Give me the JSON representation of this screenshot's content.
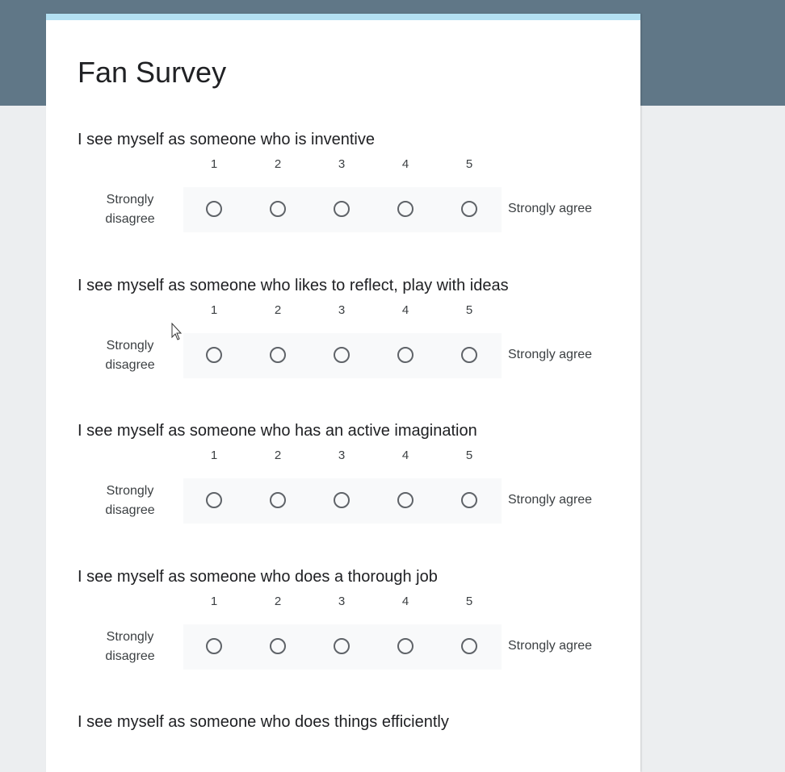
{
  "form": {
    "title": "Fan Survey",
    "questions": [
      {
        "text": "I see myself as someone who is inventive",
        "scale": [
          "1",
          "2",
          "3",
          "4",
          "5"
        ],
        "low_label": "Strongly disagree",
        "high_label": "Strongly agree"
      },
      {
        "text": "I see myself as someone who likes to reflect, play with ideas",
        "scale": [
          "1",
          "2",
          "3",
          "4",
          "5"
        ],
        "low_label": "Strongly disagree",
        "high_label": "Strongly agree"
      },
      {
        "text": "I see myself as someone who has an active imagination",
        "scale": [
          "1",
          "2",
          "3",
          "4",
          "5"
        ],
        "low_label": "Strongly disagree",
        "high_label": "Strongly agree"
      },
      {
        "text": "I see myself as someone who does a thorough job",
        "scale": [
          "1",
          "2",
          "3",
          "4",
          "5"
        ],
        "low_label": "Strongly disagree",
        "high_label": "Strongly agree"
      },
      {
        "text": "I see myself as someone who does things efficiently"
      }
    ]
  },
  "colors": {
    "header": "#607787",
    "accent_strip": "#b3e0f2",
    "page_background": "#eceef0"
  }
}
